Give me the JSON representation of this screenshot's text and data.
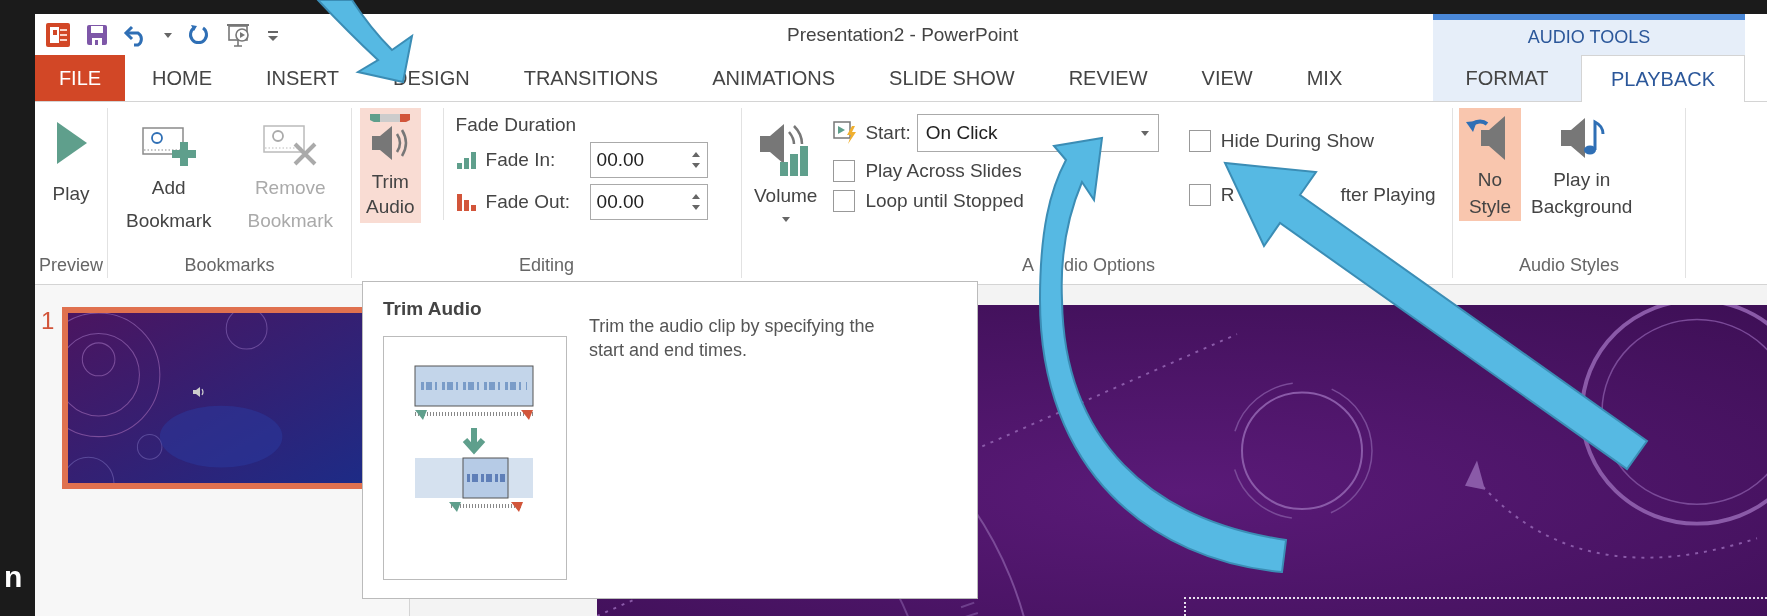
{
  "window": {
    "title": "Presentation2 - PowerPoint"
  },
  "tabs": [
    {
      "label": "FILE",
      "kind": "file",
      "selected": false
    },
    {
      "label": "HOME",
      "kind": "tab",
      "selected": false
    },
    {
      "label": "INSERT",
      "kind": "tab",
      "selected": false
    },
    {
      "label": "DESIGN",
      "kind": "tab",
      "selected": false
    },
    {
      "label": "TRANSITIONS",
      "kind": "tab",
      "selected": false
    },
    {
      "label": "ANIMATIONS",
      "kind": "tab",
      "selected": false
    },
    {
      "label": "SLIDE SHOW",
      "kind": "tab",
      "selected": false
    },
    {
      "label": "REVIEW",
      "kind": "tab",
      "selected": false
    },
    {
      "label": "VIEW",
      "kind": "tab",
      "selected": false
    },
    {
      "label": "MIX",
      "kind": "tab",
      "selected": false
    }
  ],
  "contextual_tabs": {
    "title": "AUDIO TOOLS",
    "tabs": [
      {
        "label": "FORMAT",
        "selected": false
      },
      {
        "label": "PLAYBACK",
        "selected": true
      }
    ]
  },
  "ribbon": {
    "preview": {
      "label": "Preview",
      "play": "Play"
    },
    "bookmarks": {
      "label": "Bookmarks",
      "buttons": [
        {
          "lines": [
            "Add",
            "Bookmark"
          ],
          "kind": "add",
          "disabled": false
        },
        {
          "lines": [
            "Remove",
            "Bookmark"
          ],
          "kind": "remove",
          "disabled": true
        }
      ]
    },
    "editing": {
      "label": "Editing",
      "trim": {
        "lines": [
          "Trim",
          "Audio"
        ],
        "highlighted": true
      },
      "fade_title": "Fade Duration",
      "fades": [
        {
          "label": "Fade In:",
          "value": "00.00",
          "kind": "in"
        },
        {
          "label": "Fade Out:",
          "value": "00.00",
          "kind": "out"
        }
      ]
    },
    "audio_options": {
      "label_parts": [
        "A",
        "dio Options"
      ],
      "volume": "Volume",
      "start": {
        "label": "Start:",
        "value": "On Click"
      },
      "checkboxes": [
        {
          "label_parts": [
            "Play Across Slides"
          ],
          "checked": false
        },
        {
          "label_parts": [
            "Loop until Stopped"
          ],
          "checked": false
        },
        {
          "label_parts": [
            "Hide During Show"
          ],
          "checked": false
        },
        {
          "label_parts": [
            "R",
            "fter Playing"
          ],
          "checked": false
        }
      ]
    },
    "audio_styles": {
      "label": "Audio Styles",
      "buttons": [
        {
          "lines": [
            "No",
            "Style"
          ],
          "kind": "none",
          "selected": true
        },
        {
          "lines": [
            "Play in",
            "Background"
          ],
          "kind": "background",
          "selected": false
        }
      ]
    }
  },
  "slides": [
    {
      "number": "1",
      "selected": true
    }
  ],
  "tooltip": {
    "title": "Trim Audio",
    "text": "Trim the audio clip by specifying the start and end times."
  },
  "edge_text": "n"
}
